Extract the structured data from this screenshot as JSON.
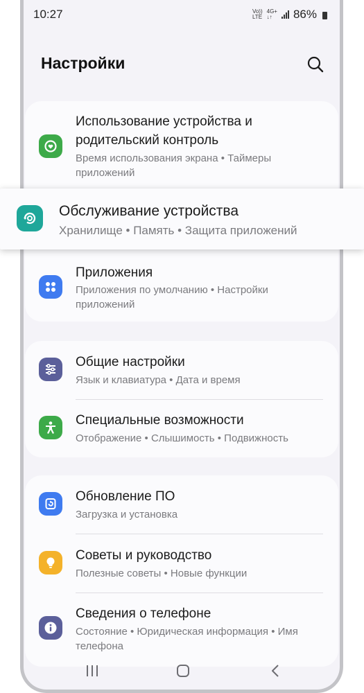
{
  "status": {
    "time": "10:27",
    "volte": "Vo))",
    "lte": "LTE",
    "net": "4G+",
    "battery": "86%"
  },
  "header": {
    "title": "Настройки"
  },
  "sections": [
    {
      "items": [
        {
          "title": "Использование устройства и",
          "title2": "родительский контроль",
          "subtitle": "Время использования экрана • Таймеры",
          "subtitle2": "приложений",
          "icon": "digital-wellbeing-icon",
          "color": "#3daa49"
        },
        {
          "title": "Приложения",
          "subtitle": "Приложения по умолчанию • Настройки",
          "subtitle2": "приложений",
          "icon": "apps-icon",
          "color": "#3f7bf0"
        }
      ]
    },
    {
      "items": [
        {
          "title": "Общие настройки",
          "subtitle": "Язык и клавиатура • Дата и время",
          "icon": "general-settings-icon",
          "color": "#5b5f9a"
        },
        {
          "title": "Специальные возможности",
          "subtitle": "Отображение • Слышимость • Подвижность",
          "icon": "accessibility-icon",
          "color": "#3daa49"
        }
      ]
    },
    {
      "items": [
        {
          "title": "Обновление ПО",
          "subtitle": "Загрузка и установка",
          "icon": "software-update-icon",
          "color": "#3f7bf0"
        },
        {
          "title": "Советы и руководство",
          "subtitle": "Полезные советы • Новые функции",
          "icon": "tips-bulb-icon",
          "color": "#f4b22a"
        },
        {
          "title": "Сведения о телефоне",
          "subtitle": "Состояние • Юридическая информация • Имя",
          "subtitle2": "телефона",
          "icon": "info-icon",
          "color": "#5b5f9a"
        }
      ]
    }
  ],
  "highlighted": {
    "title": "Обслуживание устройства",
    "subtitle": "Хранилище • Память • Защита приложений",
    "icon": "device-care-icon",
    "color": "#1fa79a"
  },
  "navbar": {
    "buttons": [
      "recents-icon",
      "home-icon",
      "back-icon"
    ]
  }
}
